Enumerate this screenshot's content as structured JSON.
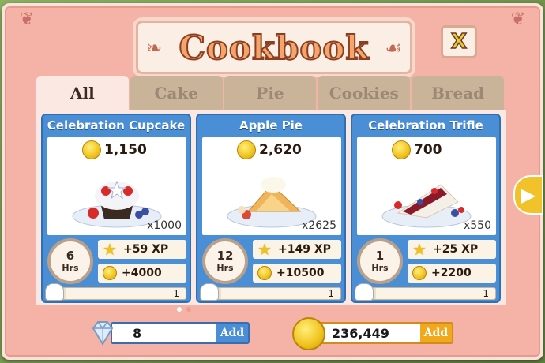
{
  "title": "Cookbook",
  "close_label": "X",
  "tabs": [
    {
      "label": "All",
      "active": true
    },
    {
      "label": "Cake",
      "active": false
    },
    {
      "label": "Pie",
      "active": false
    },
    {
      "label": "Cookies",
      "active": false
    },
    {
      "label": "Bread",
      "active": false
    }
  ],
  "recipes": [
    {
      "name": "Celebration Cupcake",
      "price": "1,150",
      "quantity": "x1000",
      "time": "6",
      "time_unit": "Hrs",
      "xp": "+59 XP",
      "coins": "+4000",
      "level": "1"
    },
    {
      "name": "Apple Pie",
      "price": "2,620",
      "quantity": "x2625",
      "time": "12",
      "time_unit": "Hrs",
      "xp": "+149 XP",
      "coins": "+10500",
      "level": "1"
    },
    {
      "name": "Celebration Trifle",
      "price": "700",
      "quantity": "x550",
      "time": "1",
      "time_unit": "Hrs",
      "xp": "+25 XP",
      "coins": "+2200",
      "level": "1"
    }
  ],
  "wallet": {
    "gems": "8",
    "coins": "236,449",
    "add_label": "Add"
  },
  "colors": {
    "panel_bg": "#f4b3a6",
    "card_blue": "#4a8fd6",
    "coin_gold": "#f0c21c",
    "tab_inactive": "#c9b49a"
  }
}
